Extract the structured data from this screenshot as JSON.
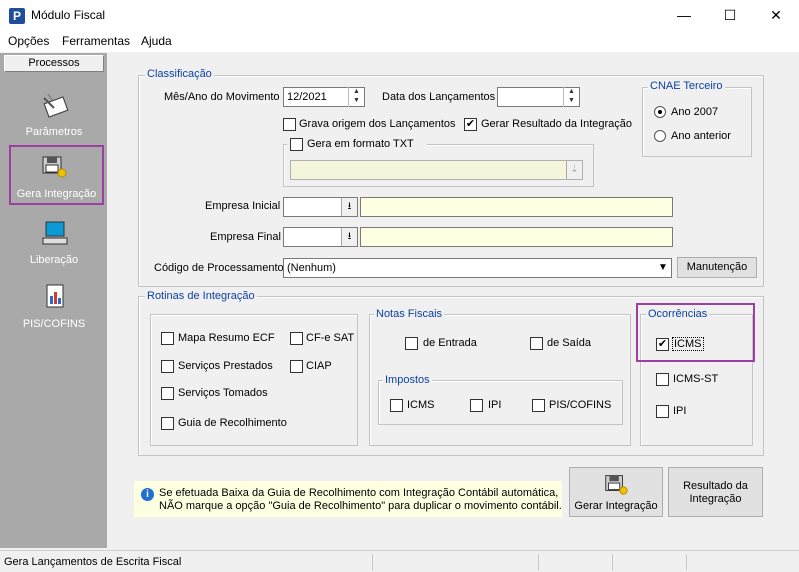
{
  "window": {
    "title": "Módulo Fiscal",
    "app_icon": "P",
    "minimize": "—",
    "maximize": "☐",
    "close": "✕"
  },
  "menu": [
    "Opções",
    "Ferramentas",
    "Ajuda"
  ],
  "left_panel": {
    "header": "Processos",
    "items": [
      {
        "label": "Parâmetros",
        "icon": "parameters-icon"
      },
      {
        "label": "Gera Integração",
        "icon": "floppy-integration-icon",
        "selected": true
      },
      {
        "label": "Liberação",
        "icon": "computer-release-icon"
      },
      {
        "label": "PIS/COFINS",
        "icon": "document-chart-icon"
      }
    ]
  },
  "classificacao": {
    "legend": "Classificação",
    "mes_ano_label": "Mês/Ano do Movimento",
    "mes_ano_value": "12/2021",
    "data_lanc_label": "Data dos Lançamentos",
    "data_lanc_value": "",
    "grava_origem_label": "Grava origem dos Lançamentos",
    "grava_origem_checked": false,
    "gerar_resultado_label": "Gerar Resultado da Integração",
    "gerar_resultado_checked": true,
    "gera_txt_label": "Gera em formato TXT",
    "gera_txt_checked": false,
    "txt_path_value": "",
    "empresa_inicial_label": "Empresa Inicial",
    "empresa_inicial_value": "",
    "empresa_inicial_name": "",
    "empresa_final_label": "Empresa Final",
    "empresa_final_value": "",
    "empresa_final_name": "",
    "codigo_proc_label": "Código de Processamento",
    "codigo_proc_value": "(Nenhum)",
    "manutencao_label": "Manutenção"
  },
  "cnae": {
    "legend": "CNAE Terceiro",
    "options": [
      "Ano 2007",
      "Ano anterior"
    ],
    "selected": 0
  },
  "rotinas": {
    "legend": "Rotinas de Integração",
    "left_items": [
      {
        "label": "Mapa Resumo ECF",
        "checked": false
      },
      {
        "label": "Serviços Prestados",
        "checked": false
      },
      {
        "label": "Serviços Tomados",
        "checked": false
      },
      {
        "label": "Guia de Recolhimento",
        "checked": false
      }
    ],
    "right_items": [
      {
        "label": "CF-e SAT",
        "checked": false
      },
      {
        "label": "CIAP",
        "checked": false
      }
    ]
  },
  "notas": {
    "legend": "Notas Fiscais",
    "entrada_label": "de Entrada",
    "saida_label": "de Saída",
    "impostos_legend": "Impostos",
    "impostos": [
      {
        "label": "ICMS",
        "checked": false
      },
      {
        "label": "IPI",
        "checked": false
      },
      {
        "label": "PIS/COFINS",
        "checked": false
      }
    ]
  },
  "ocorrencias": {
    "legend": "Ocorrências",
    "items": [
      {
        "label": "ICMS",
        "checked": true
      },
      {
        "label": "ICMS-ST",
        "checked": false
      },
      {
        "label": "IPI",
        "checked": false
      }
    ]
  },
  "info": {
    "line1": "Se efetuada Baixa da Guia de Recolhimento com Integração Contábil automática,",
    "line2": "NÃO marque a opção \"Guia de Recolhimento\" para duplicar o movimento contábil."
  },
  "buttons": {
    "gerar_integracao": "Gerar Integração",
    "resultado_line1": "Resultado da",
    "resultado_line2": "Integração"
  },
  "status": {
    "text": "Gera Lançamentos de Escrita Fiscal"
  },
  "colors": {
    "legend": "#0b3fa5",
    "highlight": "#9b3fa5",
    "left_panel": "#a9a9a9",
    "field_yellow": "#ffffe1"
  }
}
